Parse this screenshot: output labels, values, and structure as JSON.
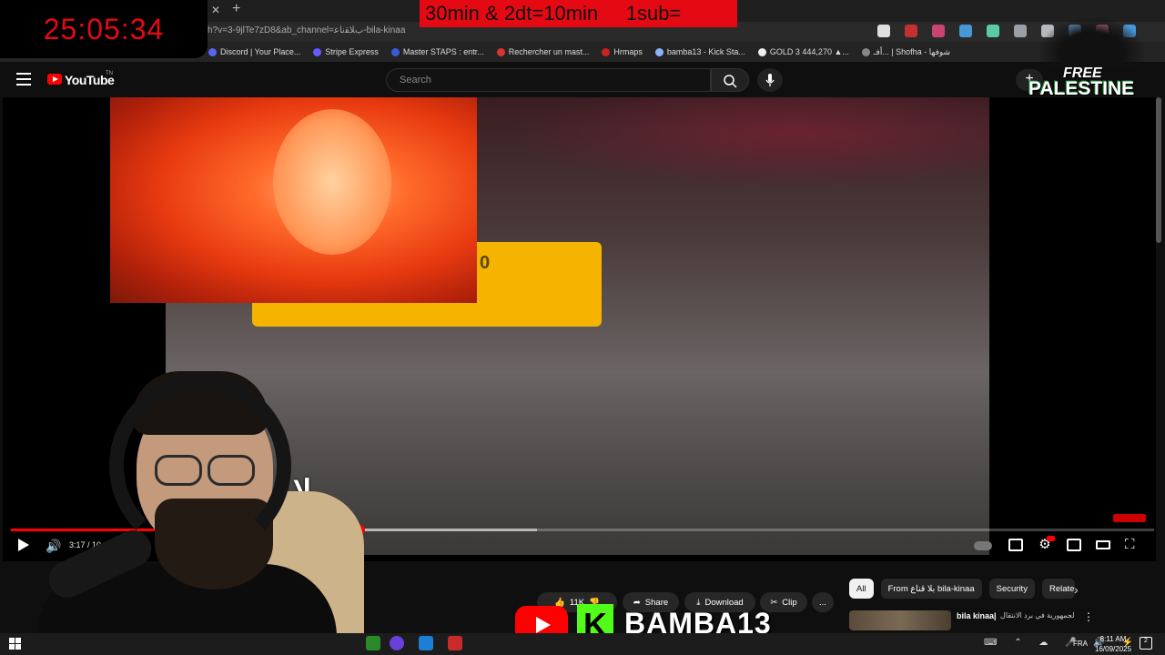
{
  "overlay": {
    "timer": "25:05:34",
    "banner": "30min & 2dt=10min     1sub="
  },
  "browser": {
    "url": "h?v=3-9jlTe7zD8&ab_channel=ﺏﻼﻘﻧﺎﻋ-bila-kinaa",
    "bookmarks": [
      {
        "label": "Discord | Your Place...",
        "color": "#5865f2"
      },
      {
        "label": "Stripe Express",
        "color": "#635bff"
      },
      {
        "label": "Master STAPS : entr...",
        "color": "#3a5bd9"
      },
      {
        "label": "Rechercher un mast...",
        "color": "#d33"
      },
      {
        "label": "Hrmaps",
        "color": "#c22"
      },
      {
        "label": "bamba13 - Kick Sta...",
        "color": "#8ab4f8"
      },
      {
        "label": "GOLD 3 444,270 ▲...",
        "color": "#eee"
      },
      {
        "label": "أفـ... | Shofha - شوفها",
        "color": "#888"
      }
    ],
    "extension_colors": [
      "#ffffff",
      "#e03131",
      "#e64980",
      "#4dabf7",
      "#63e6be",
      "#adb5bd",
      "#ced4da",
      "#74c0fc",
      "#f783ac",
      "#4dabf7"
    ]
  },
  "youtube": {
    "logo_text": "YouTube",
    "country_code": "TN",
    "search_placeholder": "Search",
    "create_label": "+"
  },
  "video": {
    "alert_text": "0",
    "subtitle_text": "لا",
    "time_display": "3:17 / 10:31",
    "progress_fraction": 0.305,
    "buffered_fraction": 0.46
  },
  "actions": {
    "likes": "11K",
    "share": "Share",
    "download": "Download",
    "clip": "Clip",
    "more": "..."
  },
  "chips": [
    "All",
    "From بلا قناع bila-kinaa",
    "Security",
    "Relate"
  ],
  "recommendation": {
    "channel": "bila kinaa|",
    "title": "حملات أمنية أيام الجيد_عقد التسريبات الجمهورية في برد الانتقال"
  },
  "palestine": {
    "line1": "FREE",
    "line2": "PALESTINE"
  },
  "bamba": {
    "k": "K",
    "name": "BAMBA13"
  },
  "taskbar": {
    "lang": "FRA",
    "time": "8:11 AM",
    "date": "16/09/2025",
    "notifications": "2"
  }
}
